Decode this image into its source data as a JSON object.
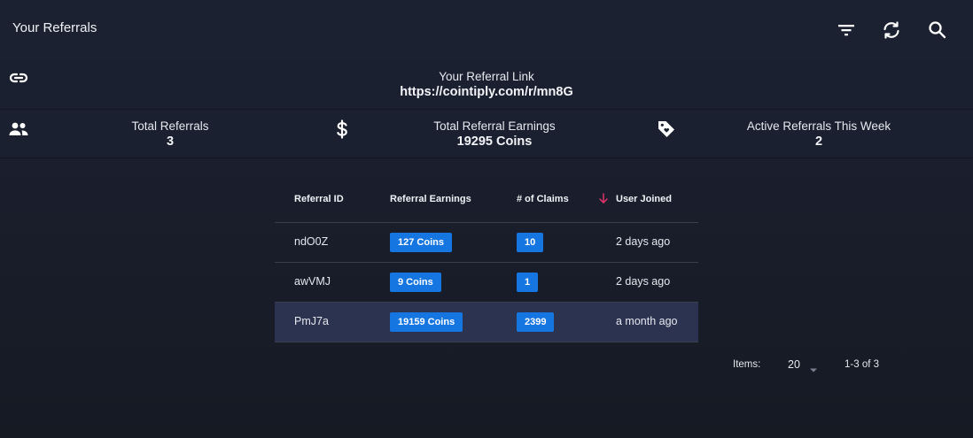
{
  "header": {
    "title": "Your Referrals",
    "icons": [
      "filter-icon",
      "refresh-icon",
      "search-icon"
    ]
  },
  "referral_link": {
    "caption": "Your Referral Link",
    "url": "https://cointiply.com/r/mn8G",
    "icon": "link-icon"
  },
  "stats": [
    {
      "label": "Total Referrals",
      "value": "3",
      "icon": "people-icon"
    },
    {
      "label": "Total Referral Earnings",
      "value": "19295 Coins",
      "icon": "dollar-icon"
    },
    {
      "label": "Active Referrals This Week",
      "value": "2",
      "icon": "tag-icon"
    }
  ],
  "table": {
    "columns": [
      "Referral ID",
      "Referral Earnings",
      "# of Claims",
      "User Joined"
    ],
    "sorted_column": "User Joined",
    "sort_direction": "descending",
    "rows": [
      {
        "id": "ndO0Z",
        "earnings": "127 Coins",
        "claims": "10",
        "joined": "2 days ago"
      },
      {
        "id": "awVMJ",
        "earnings": "9 Coins",
        "claims": "1",
        "joined": "2 days ago"
      },
      {
        "id": "PmJ7a",
        "earnings": "19159 Coins",
        "claims": "2399",
        "joined": "a month ago"
      }
    ]
  },
  "pagination": {
    "items_label": "Items:",
    "items_per_page": "20",
    "range": "1-3 of 3"
  },
  "colors": {
    "accent_chip": "#1576e2",
    "sort_arrow": "#e2336b",
    "highlight_row": "#2c3350"
  }
}
